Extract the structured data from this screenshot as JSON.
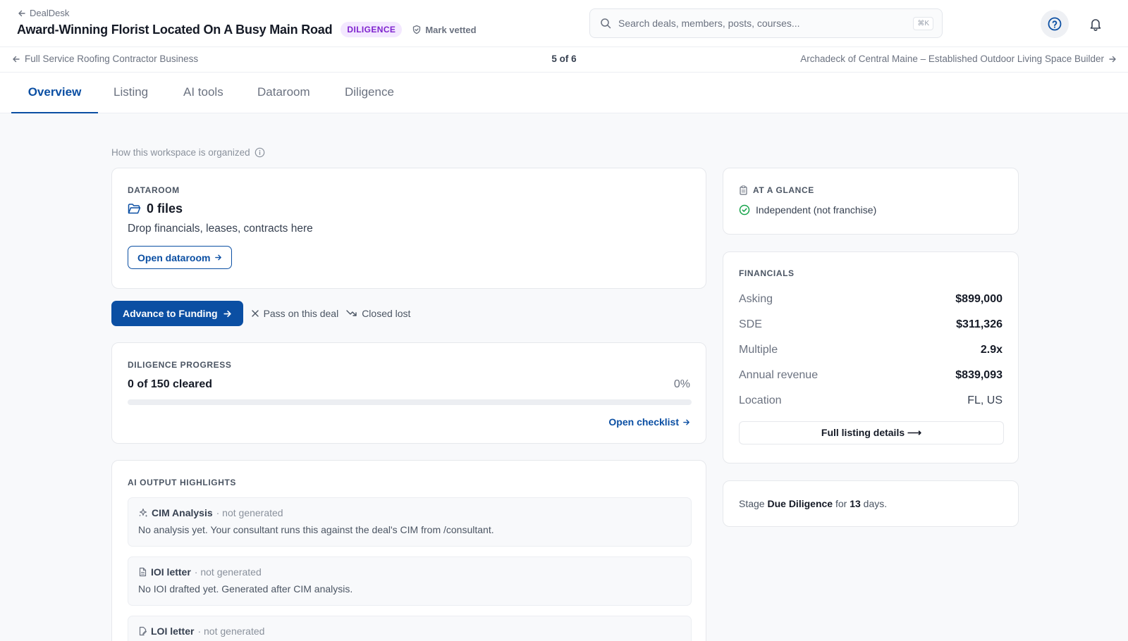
{
  "header": {
    "back_label": "DealDesk",
    "title": "Award-Winning Florist Located On A Busy Main Road",
    "stage_badge": "DILIGENCE",
    "mark_vetted_label": "Mark vetted",
    "search": {
      "placeholder": "Search deals, members, posts, courses...",
      "shortcut": "⌘K"
    }
  },
  "deal_nav": {
    "prev_label": "Full Service Roofing Contractor Business",
    "counter": "5 of 6",
    "next_label": "Archadeck of Central Maine – Established Outdoor Living Space Builder"
  },
  "tabs": [
    {
      "label": "Overview",
      "active": true
    },
    {
      "label": "Listing"
    },
    {
      "label": "AI tools"
    },
    {
      "label": "Dataroom"
    },
    {
      "label": "Diligence"
    }
  ],
  "workspace_hint": "How this workspace is organized",
  "dataroom": {
    "eyebrow": "DATAROOM",
    "files": "0 files",
    "description": "Drop financials, leases, contracts here",
    "open_label": "Open dataroom"
  },
  "actions": {
    "advance_label": "Advance to Funding",
    "pass_label": "Pass on this deal",
    "closed_lost_label": "Closed lost"
  },
  "progress": {
    "eyebrow": "DILIGENCE PROGRESS",
    "cleared": "0 of 150 cleared",
    "percent_label": "0%",
    "fraction": 0,
    "checklist_label": "Open checklist"
  },
  "ai_outputs": {
    "eyebrow": "AI OUTPUT HIGHLIGHTS",
    "items": [
      {
        "title": "CIM Analysis",
        "status": "· not generated",
        "description": "No analysis yet. Your consultant runs this against the deal's CIM from /consultant."
      },
      {
        "title": "IOI letter",
        "status": "· not generated",
        "description": "No IOI drafted yet. Generated after CIM analysis."
      },
      {
        "title": "LOI letter",
        "status": "· not generated",
        "description": ""
      }
    ]
  },
  "glance": {
    "eyebrow": "AT A GLANCE",
    "item": "Independent (not franchise)"
  },
  "financials": {
    "eyebrow": "FINANCIALS",
    "rows": [
      {
        "label": "Asking",
        "value": "$899,000"
      },
      {
        "label": "SDE",
        "value": "$311,326"
      },
      {
        "label": "Multiple",
        "value": "2.9x"
      },
      {
        "label": "Annual revenue",
        "value": "$839,093"
      },
      {
        "label": "Location",
        "value": "FL, US"
      }
    ],
    "details_label": "Full listing details ⟶"
  },
  "stage": {
    "prefix": "Stage",
    "name": "Due Diligence",
    "for": "for",
    "days": "13",
    "suffix": "days."
  },
  "colors": {
    "accent": "#0b4fa3",
    "badge_bg": "#f3e8ff",
    "badge_text": "#7e22ce",
    "success": "#16a34a"
  }
}
